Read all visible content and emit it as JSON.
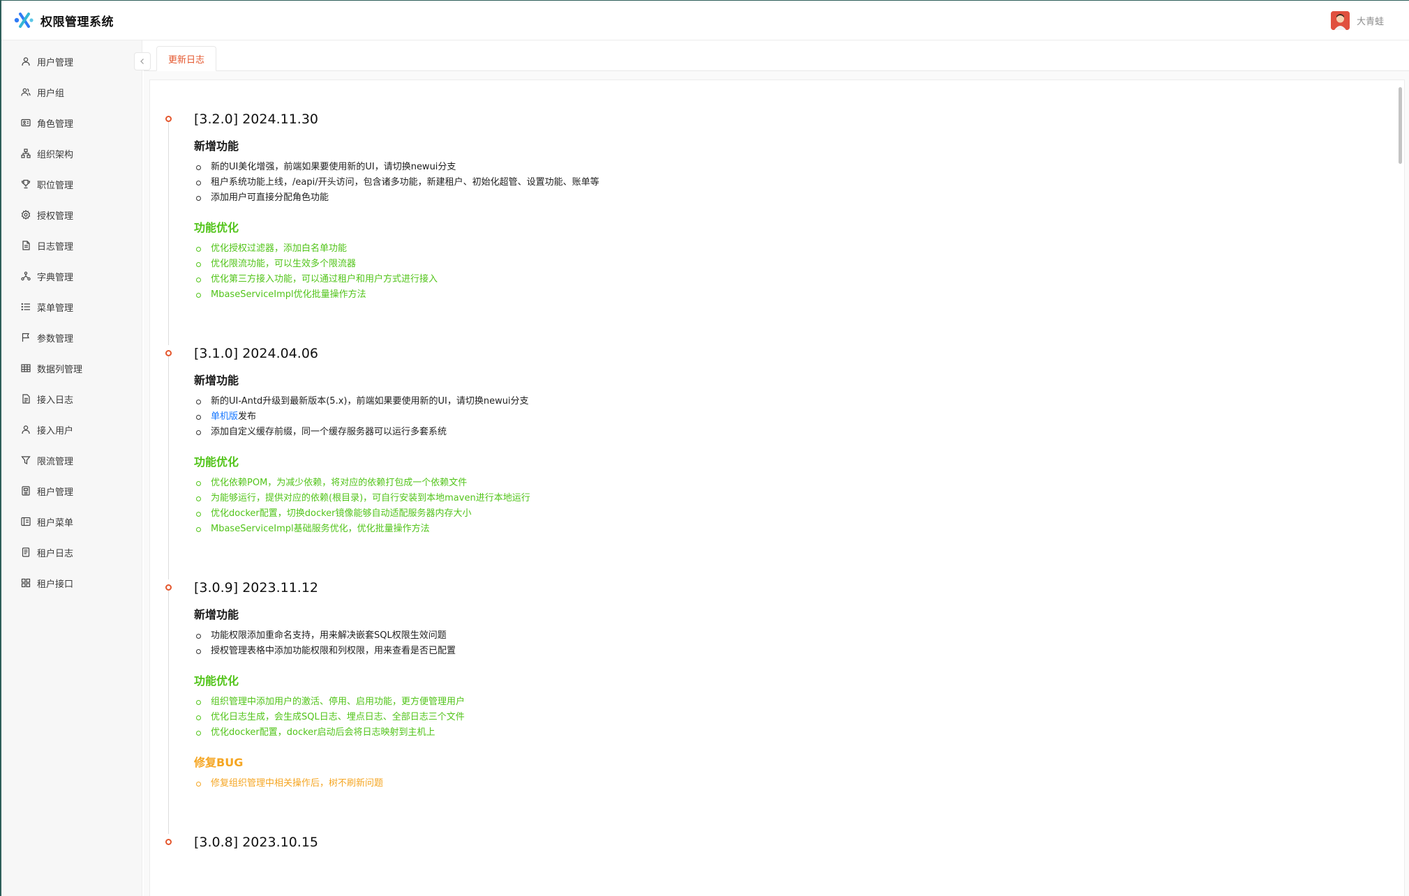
{
  "app": {
    "title": "权限管理系统",
    "user_name": "大青蛙"
  },
  "sidebar": {
    "items": [
      {
        "label": "用户管理",
        "icon": "user-icon"
      },
      {
        "label": "用户组",
        "icon": "users-icon"
      },
      {
        "label": "角色管理",
        "icon": "id-card-icon"
      },
      {
        "label": "组织架构",
        "icon": "org-tree-icon"
      },
      {
        "label": "职位管理",
        "icon": "trophy-icon"
      },
      {
        "label": "授权管理",
        "icon": "gear-icon"
      },
      {
        "label": "日志管理",
        "icon": "file-icon"
      },
      {
        "label": "字典管理",
        "icon": "network-icon"
      },
      {
        "label": "菜单管理",
        "icon": "list-icon"
      },
      {
        "label": "参数管理",
        "icon": "flag-icon"
      },
      {
        "label": "数据列管理",
        "icon": "table-icon"
      },
      {
        "label": "接入日志",
        "icon": "file-text-icon"
      },
      {
        "label": "接入用户",
        "icon": "user-icon"
      },
      {
        "label": "限流管理",
        "icon": "filter-icon"
      },
      {
        "label": "租户管理",
        "icon": "form-icon"
      },
      {
        "label": "租户菜单",
        "icon": "window-icon"
      },
      {
        "label": "租户日志",
        "icon": "doc-icon"
      },
      {
        "label": "租户接口",
        "icon": "grid-icon"
      }
    ]
  },
  "tabs": [
    {
      "label": "更新日志",
      "active": true
    }
  ],
  "changelog": [
    {
      "version": "[3.2.0] 2024.11.30",
      "new_title": "新增功能",
      "new_items": [
        "新的UI美化增强，前端如果要使用新的UI，请切换newui分支",
        "租户系统功能上线，/eapi/开头访问，包含诸多功能，新建租户、初始化超管、设置功能、账单等",
        "添加用户可直接分配角色功能"
      ],
      "opt_title": "功能优化",
      "opt_items": [
        "优化授权过滤器，添加白名单功能",
        "优化限流功能，可以生效多个限流器",
        "优化第三方接入功能，可以通过租户和用户方式进行接入",
        "MbaseServiceImpl优化批量操作方法"
      ]
    },
    {
      "version": "[3.1.0] 2024.04.06",
      "new_title": "新增功能",
      "new_items": [
        "新的UI-Antd升级到最新版本(5.x)，前端如果要使用新的UI，请切换newui分支",
        {
          "link": "单机版",
          "text": "发布"
        },
        "添加自定义缓存前缀，同一个缓存服务器可以运行多套系统"
      ],
      "opt_title": "功能优化",
      "opt_items": [
        "优化依赖POM，为减少依赖，将对应的依赖打包成一个依赖文件",
        "为能够运行，提供对应的依赖(根目录)，可自行安装到本地maven进行本地运行",
        "优化docker配置，切换docker镜像能够自动适配服务器内存大小",
        "MbaseServiceImpl基础服务优化，优化批量操作方法"
      ]
    },
    {
      "version": "[3.0.9] 2023.11.12",
      "new_title": "新增功能",
      "new_items": [
        "功能权限添加重命名支持，用来解决嵌套SQL权限生效问题",
        "授权管理表格中添加功能权限和列权限，用来查看是否已配置"
      ],
      "opt_title": "功能优化",
      "opt_items": [
        "组织管理中添加用户的激活、停用、启用功能，更方便管理用户",
        "优化日志生成，会生成SQL日志、埋点日志、全部日志三个文件",
        "优化docker配置，docker启动后会将日志映射到主机上"
      ],
      "bug_title": "修复BUG",
      "bug_items": [
        "修复组织管理中相关操作后，树不刷新问题"
      ]
    },
    {
      "version": "[3.0.8] 2023.10.15"
    }
  ],
  "colors": {
    "accent": "#e4572e",
    "optimize": "#52c41a",
    "bugfix": "#f5a623",
    "link": "#1677ff"
  }
}
